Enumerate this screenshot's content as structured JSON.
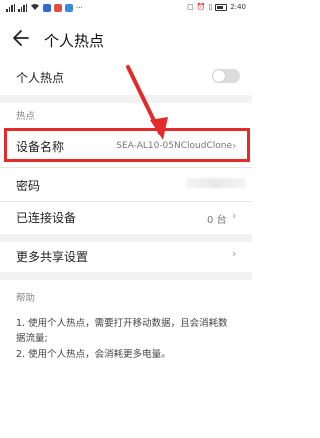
{
  "status_bar": {
    "signal_text": "",
    "time": "2:40"
  },
  "header": {
    "title": "个人热点"
  },
  "hotspot_toggle": {
    "label": "个人热点",
    "enabled": false
  },
  "section_hotspot": {
    "header": "热点",
    "device_name": {
      "label": "设备名称",
      "value": "SEA-AL10-05NCloudClone"
    },
    "password": {
      "label": "密码"
    },
    "connected_devices": {
      "label": "已连接设备",
      "value": "0 台"
    }
  },
  "more_sharing": {
    "label": "更多共享设置"
  },
  "help": {
    "header": "帮助",
    "item1_line1": "1. 使用个人热点，需要打开移动数据，且会消耗数",
    "item1_line2": "据流量;",
    "item2": "2. 使用个人热点，会消耗更多电量。"
  },
  "colors": {
    "highlight": "#e32b2b",
    "toggle_off": "#dcdcdc"
  }
}
